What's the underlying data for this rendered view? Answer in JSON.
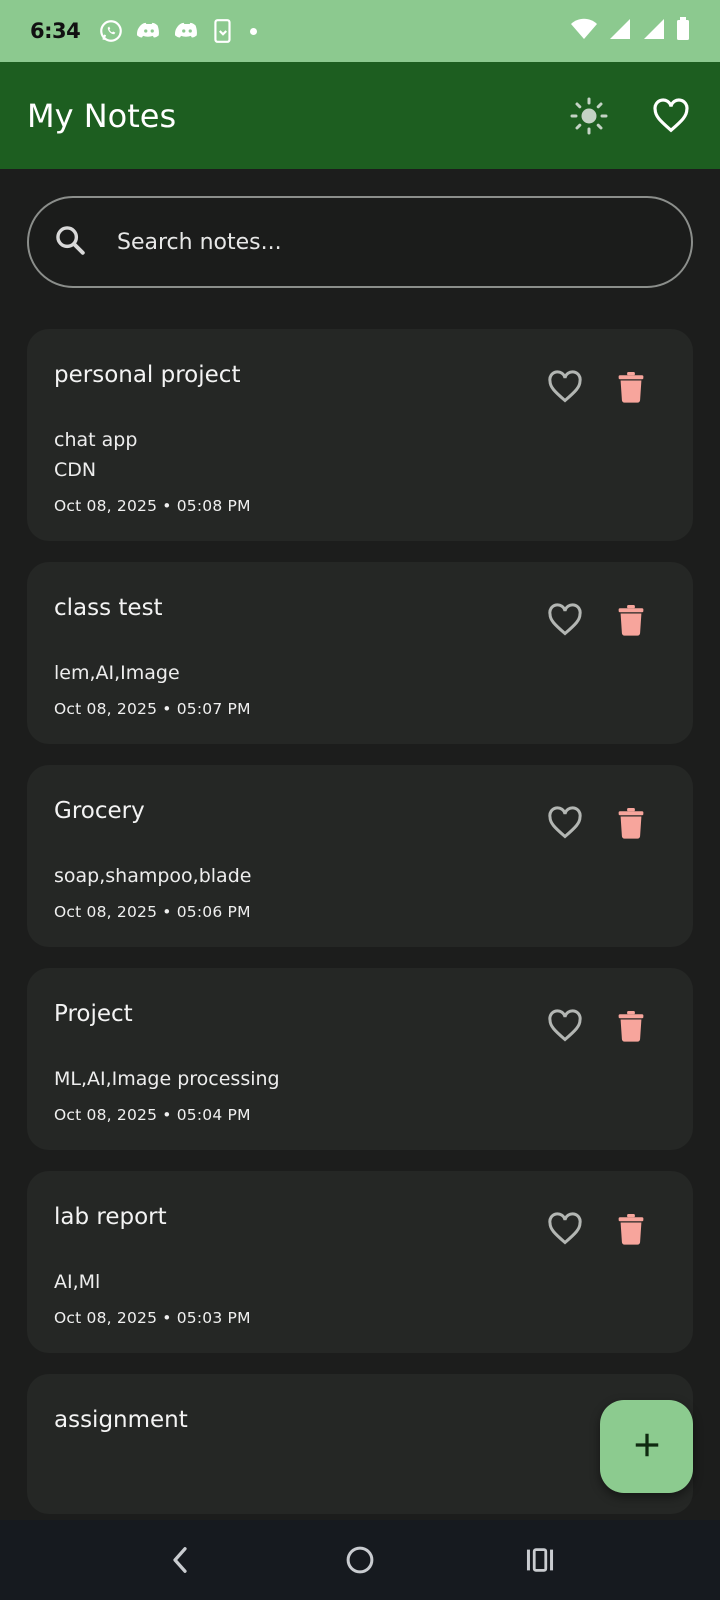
{
  "status_bar": {
    "time": "6:34",
    "bg_color": "#8cc98f"
  },
  "app_bar": {
    "title": "My Notes",
    "bg_color": "#1d5e20",
    "theme_icon": "sun-icon",
    "favorites_icon": "heart-outline-icon"
  },
  "search": {
    "placeholder": "Search notes...",
    "value": "",
    "icon": "search-icon"
  },
  "notes": [
    {
      "title": "personal project",
      "body": "chat app\nCDN",
      "date": "Oct 08, 2025 • 05:08 PM"
    },
    {
      "title": "class test",
      "body": "lem,AI,Image",
      "date": "Oct 08, 2025 • 05:07 PM"
    },
    {
      "title": "Grocery",
      "body": "soap,shampoo,blade",
      "date": "Oct 08, 2025 • 05:06 PM"
    },
    {
      "title": "Project",
      "body": "ML,AI,Image processing",
      "date": "Oct 08, 2025 • 05:04 PM"
    },
    {
      "title": "lab report",
      "body": "AI,Ml",
      "date": "Oct 08, 2025 • 05:03 PM"
    },
    {
      "title": "assignment",
      "body": "",
      "date": ""
    }
  ],
  "note_actions": {
    "favorite_icon": "heart-outline-icon",
    "delete_icon": "trash-icon",
    "delete_color": "#f7a59c"
  },
  "fab": {
    "icon": "plus-icon",
    "bg_color": "#8ccb8f"
  },
  "nav_bar": {
    "back_icon": "back-chevron-icon",
    "home_icon": "home-circle-icon",
    "recents_icon": "recents-icon"
  }
}
